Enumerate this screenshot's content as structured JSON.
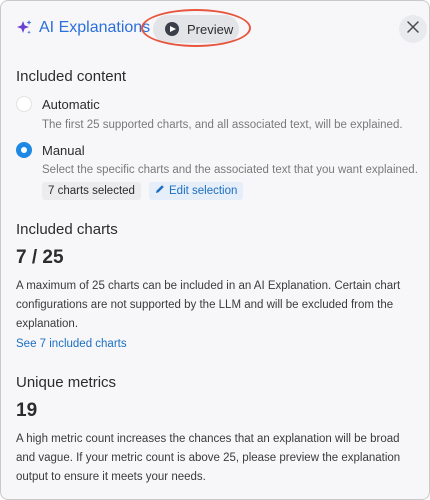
{
  "header": {
    "title": "AI Explanations",
    "preview_label": "Preview"
  },
  "included_content": {
    "heading": "Included content",
    "options": [
      {
        "label": "Automatic",
        "description": "The first 25 supported charts, and all associated text, will be explained.",
        "selected": false
      },
      {
        "label": "Manual",
        "description": "Select the specific charts and the associated text that you want explained.",
        "selected": true
      }
    ],
    "selection_chip": "7 charts selected",
    "edit_selection_label": "Edit selection"
  },
  "included_charts": {
    "heading": "Included charts",
    "count": "7 / 25",
    "description": "A maximum of 25 charts can be included in an AI Explanation. Certain chart configurations are not supported by the LLM and will be excluded from the explanation.",
    "link_label": "See 7 included charts"
  },
  "unique_metrics": {
    "heading": "Unique metrics",
    "count": "19",
    "description": "A high metric count increases the chances that an explanation will be broad and vague. If your metric count is above 25, please preview the explanation output to ensure it meets your needs."
  },
  "colors": {
    "accent": "#2a6fdb",
    "link": "#1b6fc2",
    "radio_selected": "#1e88e5",
    "highlight_ring": "#e7563e",
    "panel_background": "#f7f7f9"
  },
  "icons": [
    "sparkle-icon",
    "play-icon",
    "close-icon",
    "pencil-icon"
  ]
}
